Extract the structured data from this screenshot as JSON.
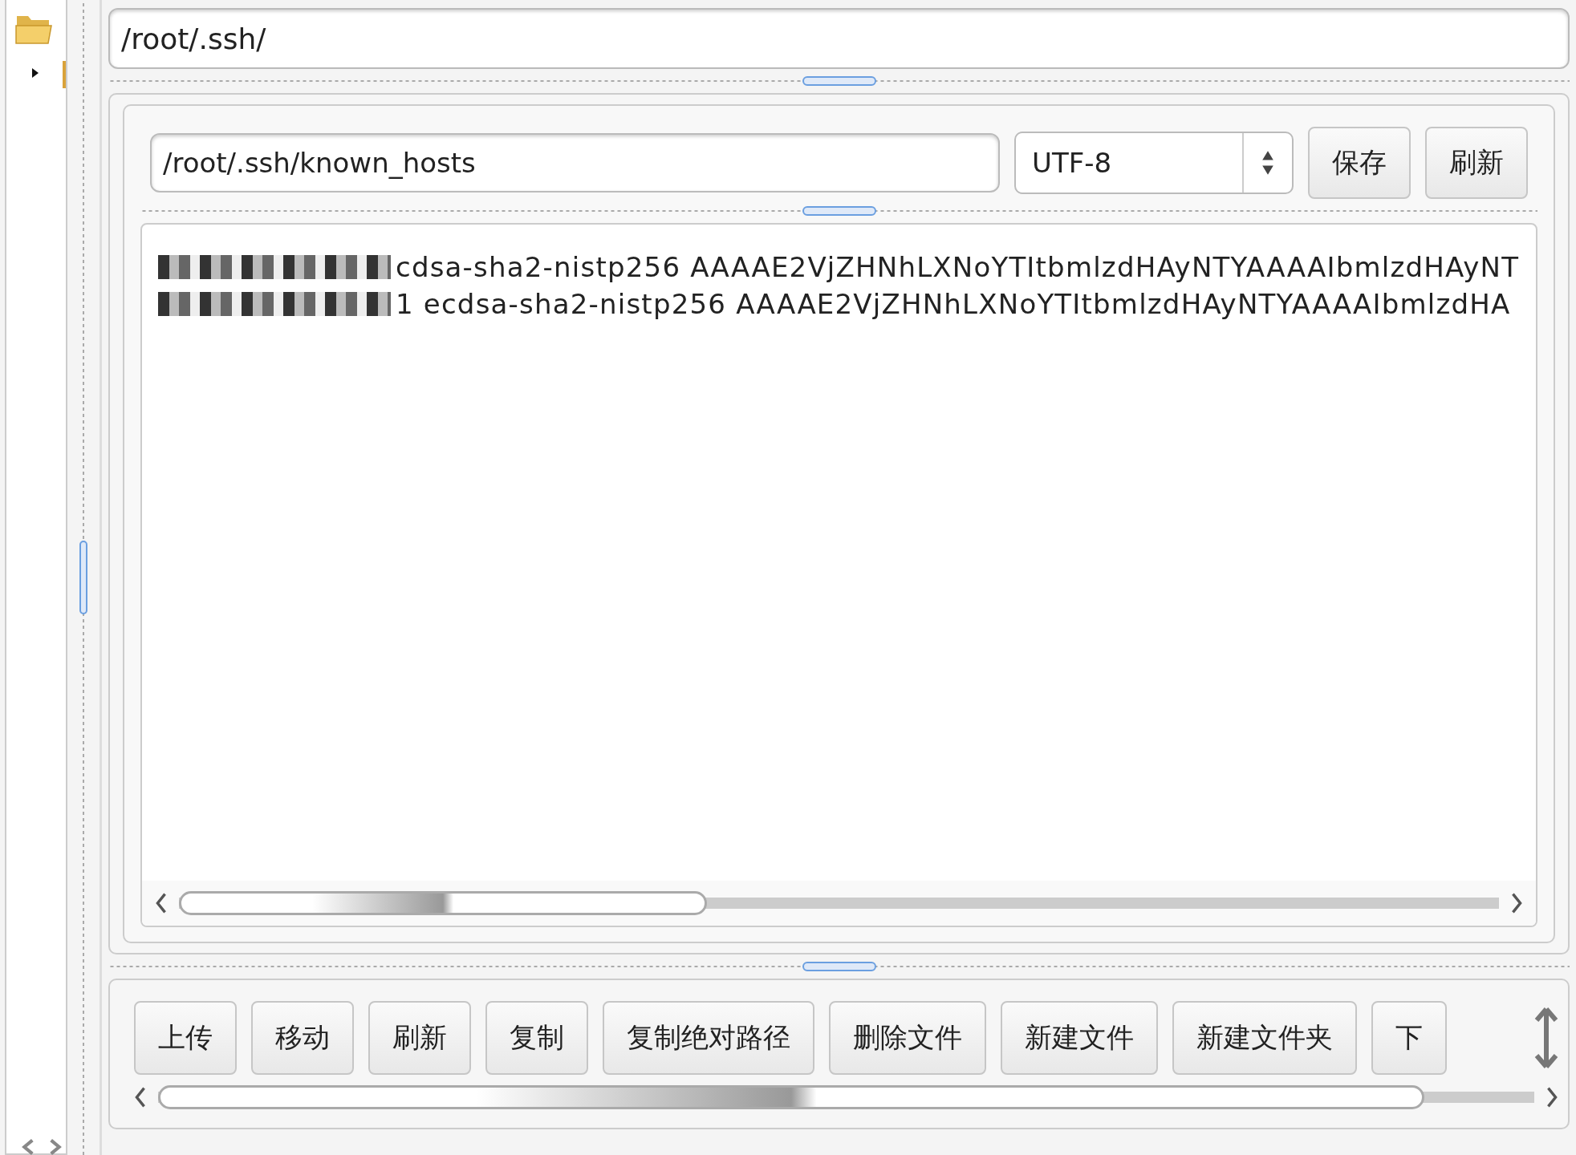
{
  "directory_path": "/root/.ssh/",
  "editor": {
    "file_path": "/root/.ssh/known_hosts",
    "encoding": "UTF-8",
    "buttons": [
      "保存",
      "刷新"
    ],
    "lines": [
      {
        "redacted": true,
        "text": "cdsa-sha2-nistp256 AAAAE2VjZHNhLXNoYTItbmlzdHAyNTYAAAAIbmlzdHAyNT"
      },
      {
        "redacted": true,
        "text": "1 ecdsa-sha2-nistp256 AAAAE2VjZHNhLXNoYTItbmlzdHAyNTYAAAAIbmlzdHA"
      }
    ]
  },
  "actions": [
    "上传",
    "移动",
    "刷新",
    "复制",
    "复制绝对路径",
    "删除文件",
    "新建文件",
    "新建文件夹",
    "下"
  ]
}
